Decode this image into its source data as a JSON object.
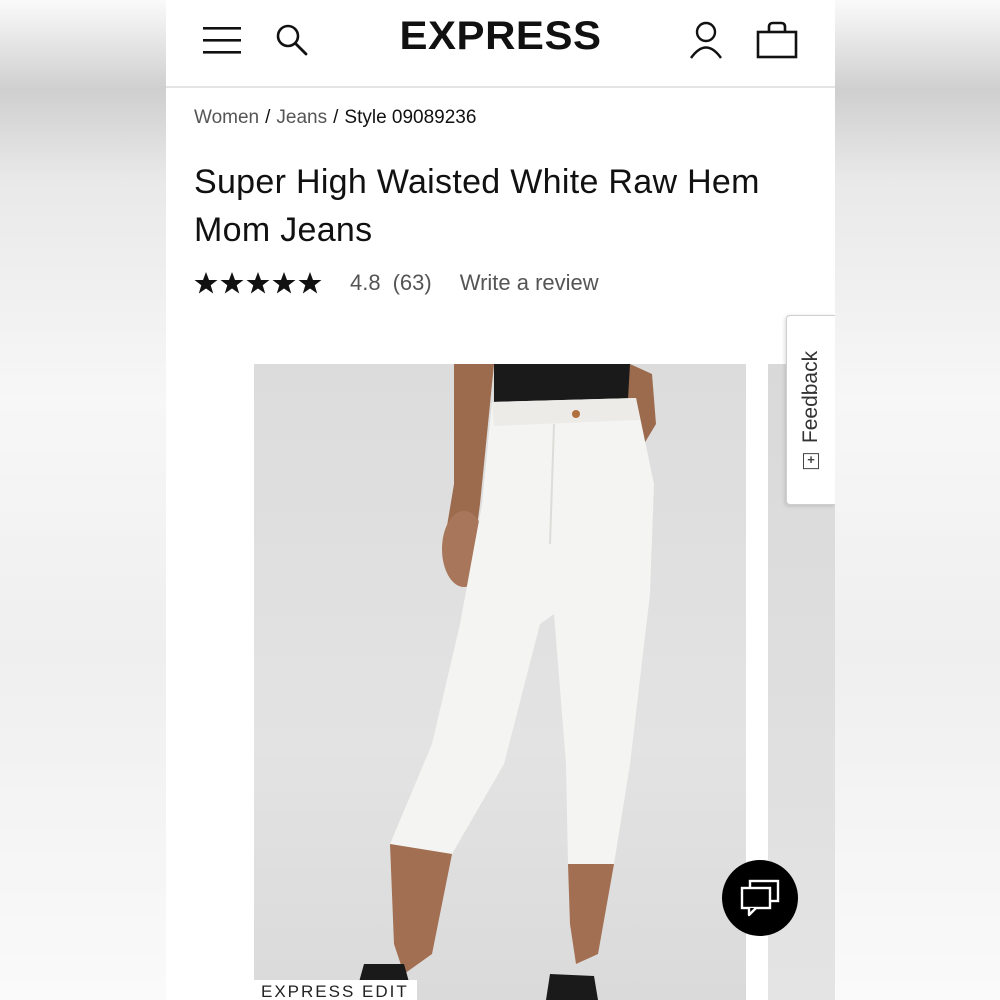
{
  "header": {
    "logo": "EXPRESS",
    "icons": [
      "menu-icon",
      "search-icon",
      "account-icon",
      "shopping-bag-icon"
    ]
  },
  "breadcrumb": {
    "items": [
      "Women",
      "Jeans"
    ],
    "separator": "/",
    "current": "Style 09089236"
  },
  "product": {
    "title_line1": "Super High Waisted White Raw Hem",
    "title_line2": "Mom Jeans",
    "rating": {
      "stars": 5,
      "value": "4.8",
      "count": "(63)",
      "write_review": "Write a review"
    }
  },
  "gallery": {
    "badge": "EXPRESS EDIT"
  },
  "feedback": {
    "label": "Feedback",
    "plus": "+"
  },
  "chat": {
    "icon": "chat-bubbles-icon"
  },
  "colors": {
    "text": "#111111",
    "muted": "#555555",
    "image_bg": "#dedede",
    "chat_bg": "#000000"
  }
}
